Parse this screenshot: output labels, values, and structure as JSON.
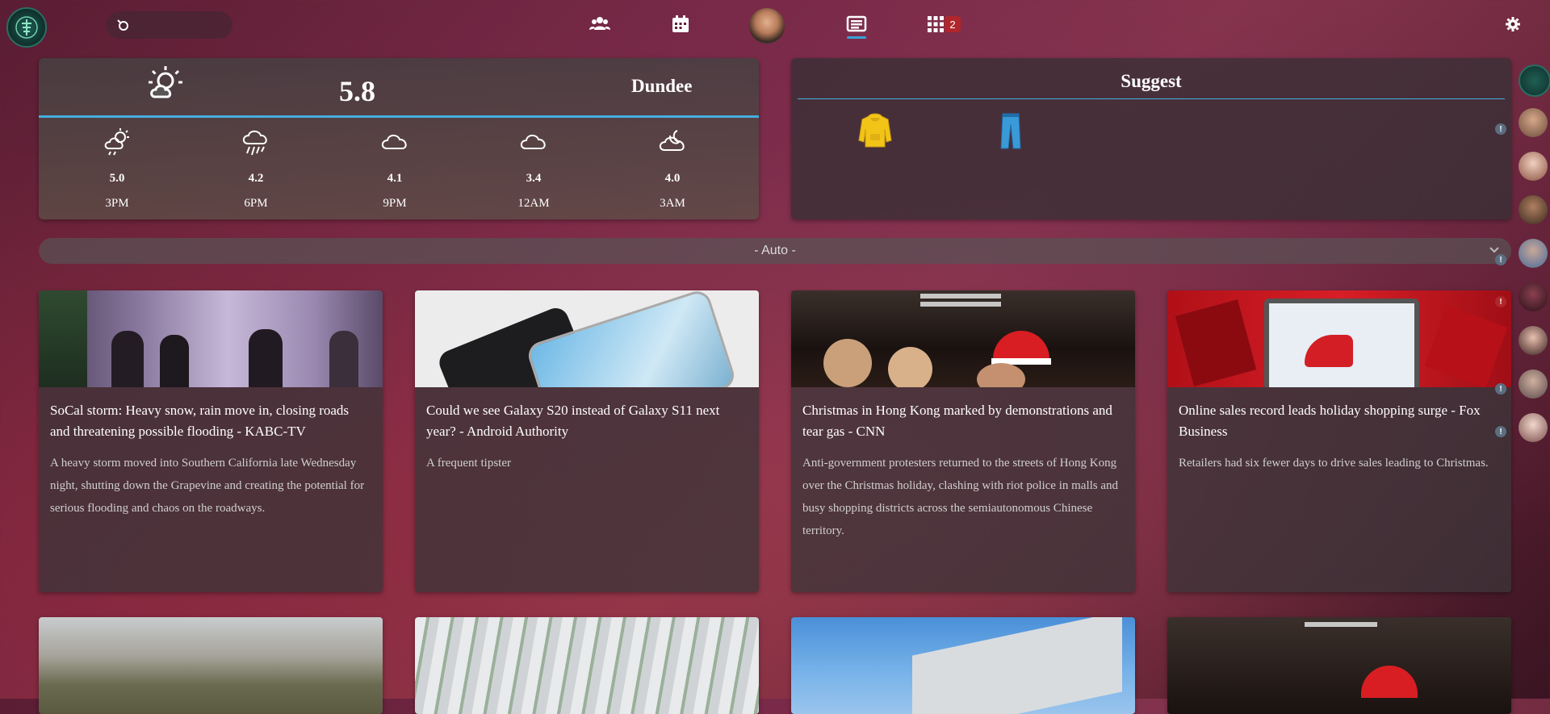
{
  "header": {
    "badge_count": "2"
  },
  "weather": {
    "current_temp": "5.8",
    "city": "Dundee",
    "forecast": [
      {
        "temp": "5.0",
        "hour": "3PM",
        "icon": "partly-sunny-rain-icon"
      },
      {
        "temp": "4.2",
        "hour": "6PM",
        "icon": "rain-icon"
      },
      {
        "temp": "4.1",
        "hour": "9PM",
        "icon": "cloud-icon"
      },
      {
        "temp": "3.4",
        "hour": "12AM",
        "icon": "cloud-icon"
      },
      {
        "temp": "4.0",
        "hour": "3AM",
        "icon": "partly-cloudy-night-icon"
      }
    ]
  },
  "suggest": {
    "title": "Suggest",
    "items": [
      "hoodie-icon",
      "jeans-icon"
    ]
  },
  "feed_selector": {
    "value": "- Auto -"
  },
  "news": [
    {
      "title": "SoCal storm: Heavy snow, rain move in, closing roads and threatening possible flooding - KABC-TV",
      "desc": "A heavy storm moved into Southern California late Wednesday night, shutting down the Grapevine and creating the potential for serious flooding and chaos on the roadways."
    },
    {
      "title": "Could we see Galaxy S20 instead of Galaxy S11 next year? - Android Authority",
      "desc": "A frequent tipster"
    },
    {
      "title": "Christmas in Hong Kong marked by demonstrations and tear gas - CNN",
      "desc": "Anti-government protesters returned to the streets of Hong Kong over the Christmas holiday, clashing with riot police in malls and busy shopping districts across the semiautonomous Chinese territory."
    },
    {
      "title": "Online sales record leads holiday shopping surge - Fox Business",
      "desc": "Retailers had six fewer days to drive sales leading to Christmas."
    }
  ],
  "colors": {
    "accent": "#46aee0",
    "badge": "#b0262b"
  }
}
